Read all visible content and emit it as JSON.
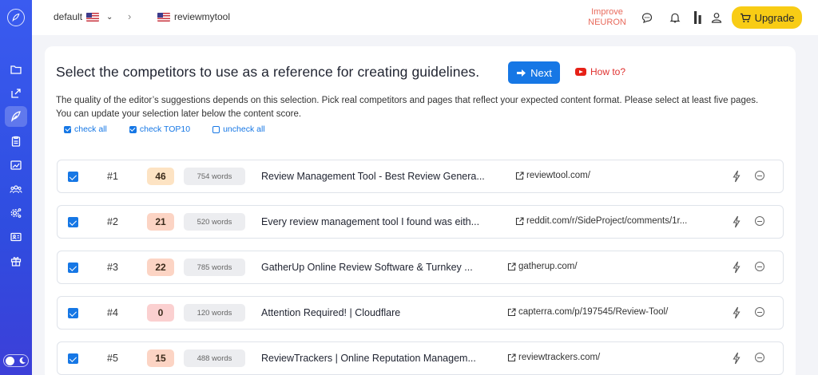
{
  "header": {
    "project": "default",
    "separator": "›",
    "site": "reviewmytool",
    "improve_line1": "Improve",
    "improve_line2": "NEURON",
    "upgrade_label": "Upgrade"
  },
  "sidebar": {
    "items": [
      "folder-icon",
      "export-icon",
      "feather-icon",
      "clipboard-icon",
      "chart-icon",
      "team-icon",
      "settings-icon",
      "id-card-icon",
      "gift-icon"
    ],
    "active": "feather-icon"
  },
  "main": {
    "heading": "Select the competitors to use as a reference for creating guidelines.",
    "next_label": "Next",
    "howto_label": "How to?",
    "description": "The quality of the editor’s suggestions depends on this selection. Pick real competitors and pages that reflect your expected content format. Please select at least five pages. You can update your selection later below the content score.",
    "check_all": "check all",
    "check_top10": "check TOP10",
    "uncheck_all": "uncheck all"
  },
  "competitors": [
    {
      "rank": "#1",
      "score": "46",
      "words": "754 words",
      "title": "Review Management Tool - Best Review Genera...",
      "url": "reviewtool.com/",
      "score_color": "#fde3c3"
    },
    {
      "rank": "#2",
      "score": "21",
      "words": "520 words",
      "title": "Every review management tool I found was eith...",
      "url": "reddit.com/r/SideProject/comments/1r...",
      "score_color": "#fcd4c4"
    },
    {
      "rank": "#3",
      "score": "22",
      "words": "785 words",
      "title": "GatherUp Online Review Software & Turnkey ...",
      "url": "gatherup.com/",
      "score_color": "#fcd4c4"
    },
    {
      "rank": "#4",
      "score": "0",
      "words": "120 words",
      "title": "Attention Required! | Cloudflare",
      "url": "capterra.com/p/197545/Review-Tool/",
      "score_color": "#fbd0d0"
    },
    {
      "rank": "#5",
      "score": "15",
      "words": "488 words",
      "title": "ReviewTrackers | Online Reputation Managem...",
      "url": "reviewtrackers.com/",
      "score_color": "#fcd4c4"
    }
  ],
  "colors": {
    "accent": "#1677e5",
    "upgrade": "#f8cc15",
    "sidebar": "#3a5bf0",
    "improve": "#e86a5c"
  }
}
